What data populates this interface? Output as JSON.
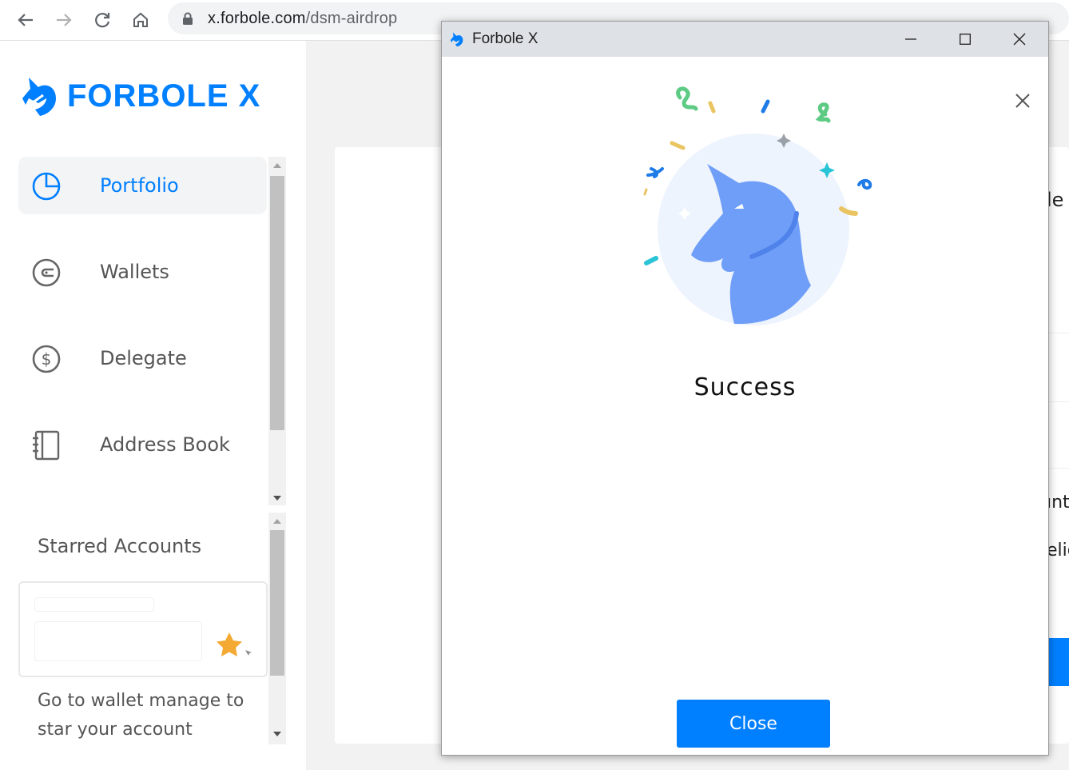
{
  "browser": {
    "url_host": "x.forbole.com",
    "url_path": "/dsm-airdrop"
  },
  "sidebar": {
    "logo_text": "FORBOLE X",
    "items": [
      {
        "label": "Portfolio",
        "icon": "pie-chart-icon",
        "active": true
      },
      {
        "label": "Wallets",
        "icon": "wallet-icon",
        "active": false
      },
      {
        "label": "Delegate",
        "icon": "dollar-icon",
        "active": false
      },
      {
        "label": "Address Book",
        "icon": "address-book-icon",
        "active": false
      }
    ],
    "starred_title": "Starred Accounts",
    "starred_hint": "Go to wallet manage to star your account"
  },
  "main": {
    "peek_1": "le",
    "peek_2": "ınt",
    "peek_3": "elig"
  },
  "popup": {
    "window_title": "Forbole X",
    "message": "Success",
    "close_label": "Close"
  },
  "colors": {
    "accent": "#007fff",
    "unicorn": "#6f9ef8",
    "circle": "#eef4fd"
  }
}
